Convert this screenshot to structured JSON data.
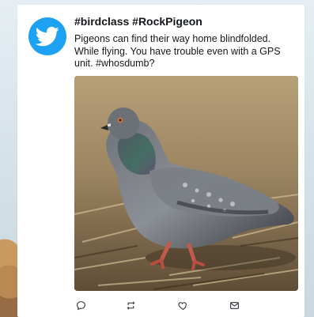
{
  "tweet": {
    "title": "#birdclass #RockPigeon",
    "body": "Pigeons can find their way home blindfolded. While flying. You have trouble even with a GPS unit. #whosdumb?"
  },
  "brand": {
    "accent": "#1da1f2",
    "avatar_icon": "twitter-bird-icon"
  },
  "actions": [
    {
      "icon": "reply-icon"
    },
    {
      "icon": "retweet-icon"
    },
    {
      "icon": "like-icon"
    },
    {
      "icon": "message-icon"
    }
  ]
}
